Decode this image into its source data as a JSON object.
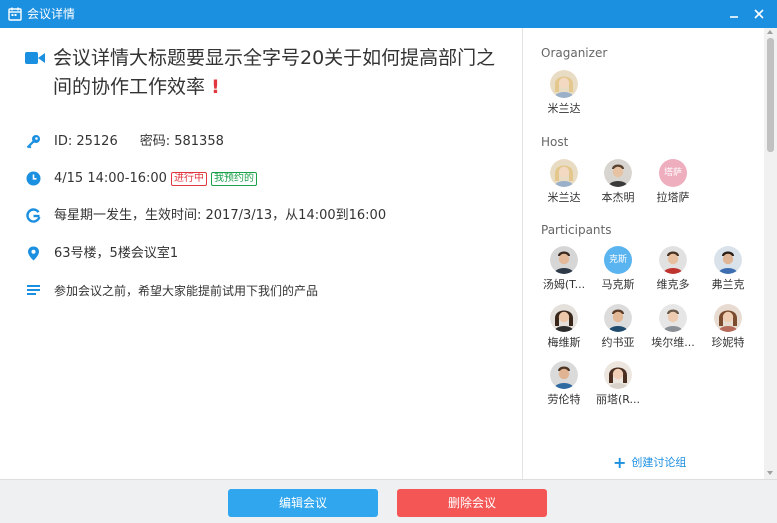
{
  "window": {
    "title": "会议详情"
  },
  "meeting": {
    "title": "会议详情大标题要显示全字号20关于如何提高部门之间的协作工作效率",
    "important_mark": "!",
    "id_text": "ID: 25126",
    "password_text": "密码: 581358",
    "time_text": "4/15 14:00-16:00",
    "status_tag": "进行中",
    "reserved_tag": "我预约的",
    "recurrence_text": "每星期一发生，生效时间: 2017/3/13，从14:00到16:00",
    "location_text": "63号楼，5楼会议室1",
    "description_text": "参加会议之前，希望大家能提前试用下我们的产品"
  },
  "sidebar": {
    "organizer_title": "Oraganizer",
    "host_title": "Host",
    "participants_title": "Participants",
    "organizer": [
      {
        "name": "米兰达"
      }
    ],
    "hosts": [
      {
        "name": "米兰达"
      },
      {
        "name": "本杰明"
      },
      {
        "name": "拉塔萨",
        "avatar_text": "塔萨"
      }
    ],
    "participants": [
      {
        "name": "汤姆(T..."
      },
      {
        "name": "马克斯",
        "avatar_text": "克斯"
      },
      {
        "name": "维克多"
      },
      {
        "name": "弗兰克"
      },
      {
        "name": "梅维斯"
      },
      {
        "name": "约书亚"
      },
      {
        "name": "埃尔维..."
      },
      {
        "name": "珍妮特"
      },
      {
        "name": "劳伦特"
      },
      {
        "name": "丽塔(R..."
      }
    ],
    "create_group_label": "创建讨论组"
  },
  "footer": {
    "edit_label": "编辑会议",
    "delete_label": "删除会议"
  },
  "colors": {
    "accent": "#1b8fe0",
    "edit_button": "#2fa6ee",
    "delete_button": "#f45656",
    "status_red": "#e0383e",
    "status_green": "#1aa14a"
  },
  "icons": {
    "title_bar": "calendar-icon",
    "heading": "video-camera-icon",
    "id": "key-icon",
    "time": "clock-icon",
    "recurrence": "recurrence-g-icon",
    "location": "location-pin-icon",
    "description": "description-lines-icon"
  }
}
